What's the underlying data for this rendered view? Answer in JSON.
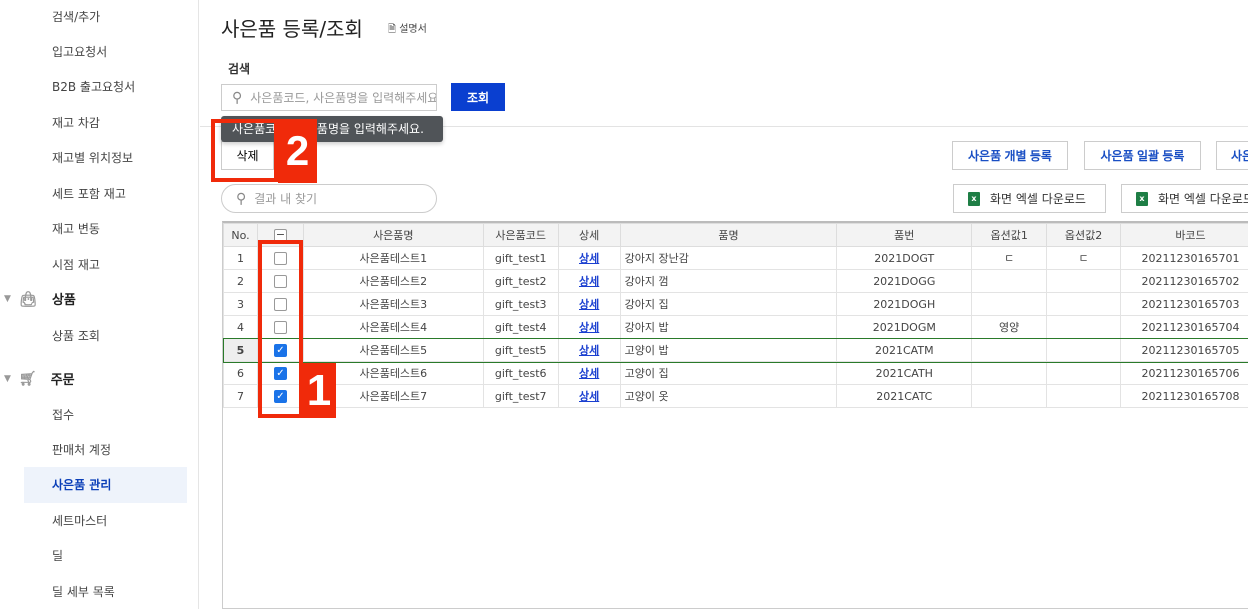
{
  "sidebar": {
    "items_top": [
      "검색/추가",
      "입고요청서",
      "B2B 출고요청서",
      "재고 차감",
      "재고별 위치정보",
      "세트 포함 재고",
      "재고 변동",
      "시점 재고"
    ],
    "group_product": {
      "label": "상품",
      "icon": "shopping-bag-icon",
      "items": [
        "상품 조회"
      ]
    },
    "group_order": {
      "label": "주문",
      "icon": "cart-icon",
      "items": [
        "접수",
        "판매처 계정",
        "사은품 관리",
        "세트마스터",
        "딜",
        "딜 세부 목록"
      ]
    },
    "selected": "사은품 관리"
  },
  "header": {
    "title": "사은품 등록/조회",
    "manual": "설명서"
  },
  "search": {
    "label": "검색",
    "placeholder": "사은품코드, 사은품명을 입력해주세요.",
    "button": "조회",
    "tooltip": "사은품코드, 사은품명을 입력해주세요."
  },
  "toolbar": {
    "delete": "삭제",
    "register_single": "사은품 개별 등록",
    "register_bulk": "사은품 일괄 등록",
    "register_more": "사은",
    "find_placeholder": "결과 내 찾기",
    "excel1": "화면 엑셀 다운로드",
    "excel2": "화면 엑셀 다운로드"
  },
  "table": {
    "headers": [
      "No.",
      "",
      "사은품명",
      "사은품코드",
      "상세",
      "품명",
      "품번",
      "옵션값1",
      "옵션값2",
      "바코드"
    ],
    "rows": [
      {
        "no": "1",
        "checked": false,
        "name": "사은품테스트1",
        "code": "gift_test1",
        "detail": "상세",
        "item": "강아지 장난감",
        "sku": "2021DOGT",
        "opt1": "ㄷ",
        "opt2": "ㄷ",
        "barcode": "20211230165701"
      },
      {
        "no": "2",
        "checked": false,
        "name": "사은품테스트2",
        "code": "gift_test2",
        "detail": "상세",
        "item": "강아지 껌",
        "sku": "2021DOGG",
        "opt1": "",
        "opt2": "",
        "barcode": "20211230165702"
      },
      {
        "no": "3",
        "checked": false,
        "name": "사은품테스트3",
        "code": "gift_test3",
        "detail": "상세",
        "item": "강아지 집",
        "sku": "2021DOGH",
        "opt1": "",
        "opt2": "",
        "barcode": "20211230165703"
      },
      {
        "no": "4",
        "checked": false,
        "name": "사은품테스트4",
        "code": "gift_test4",
        "detail": "상세",
        "item": "강아지 밥",
        "sku": "2021DOGM",
        "opt1": "영양",
        "opt2": "",
        "barcode": "20211230165704"
      },
      {
        "no": "5",
        "checked": true,
        "name": "사은품테스트5",
        "code": "gift_test5",
        "detail": "상세",
        "item": "고양이 밥",
        "sku": "2021CATM",
        "opt1": "",
        "opt2": "",
        "barcode": "20211230165705"
      },
      {
        "no": "6",
        "checked": true,
        "name": "사은품테스트6",
        "code": "gift_test6",
        "detail": "상세",
        "item": "고양이 집",
        "sku": "2021CATH",
        "opt1": "",
        "opt2": "",
        "barcode": "20211230165706"
      },
      {
        "no": "7",
        "checked": true,
        "name": "사은품테스트7",
        "code": "gift_test7",
        "detail": "상세",
        "item": "고양이 옷",
        "sku": "2021CATC",
        "opt1": "",
        "opt2": "",
        "barcode": "20211230165708"
      }
    ]
  },
  "annotations": {
    "step1": "1",
    "step2": "2"
  },
  "colors": {
    "primary": "#0a3fd0",
    "annotation": "#f02a0a",
    "checkbox": "#1a73e8"
  }
}
